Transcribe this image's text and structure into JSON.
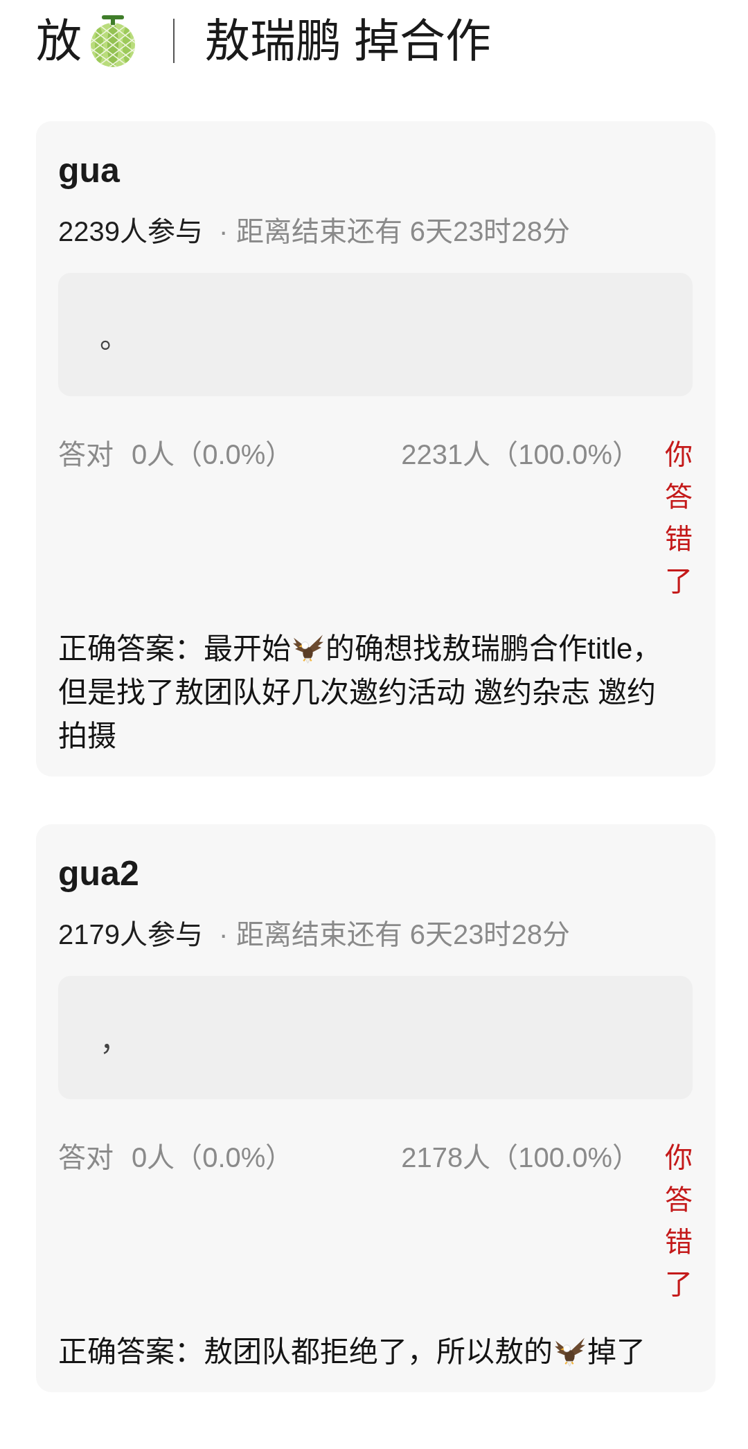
{
  "header": {
    "prefix": "放",
    "title": "敖瑞鹏 掉合作"
  },
  "questions": [
    {
      "title": "gua",
      "participants": "2239人参与",
      "countdown": "· 距离结束还有 6天23时28分",
      "answer": "。",
      "stats": {
        "correct_label": "答对",
        "correct_count": "0人（0.0%）",
        "wrong_count": "2231人（100.0%）"
      },
      "result": {
        "text": "你答错了",
        "correct": false
      },
      "solution": [
        {
          "kind": "text",
          "text": "正确答案：最开始"
        },
        {
          "kind": "icon"
        },
        {
          "kind": "text",
          "text": "的确想找敖瑞鹏合作title，但是找了敖团队好几次邀约活动 邀约杂志 邀约拍摄"
        }
      ]
    },
    {
      "title": "gua2",
      "participants": "2179人参与",
      "countdown": "· 距离结束还有 6天23时28分",
      "answer": "，",
      "stats": {
        "correct_label": "答对",
        "correct_count": "0人（0.0%）",
        "wrong_count": "2178人（100.0%）"
      },
      "result": {
        "text": "你答错了",
        "correct": false
      },
      "solution": [
        {
          "kind": "text",
          "text": "正确答案：敖团队都拒绝了，所以敖的"
        },
        {
          "kind": "icon"
        },
        {
          "kind": "text",
          "text": "掉了"
        }
      ]
    }
  ]
}
